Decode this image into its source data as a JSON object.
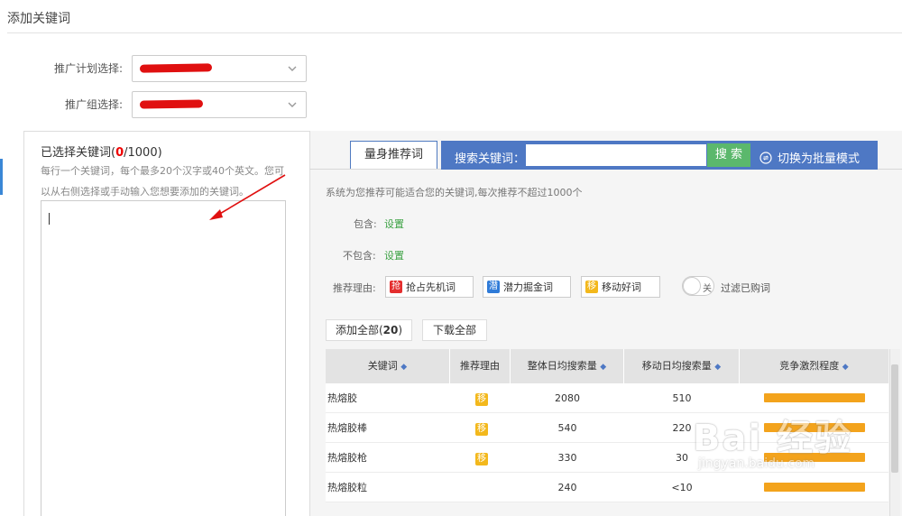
{
  "page_title": "添加关键词",
  "form": {
    "plan_label": "推广计划选择:",
    "group_label": "推广组选择:"
  },
  "selected": {
    "title_prefix": "已选择关键词(",
    "count": "0",
    "title_suffix": "/1000)",
    "hint_line1": "每行一个关键词，每个最多20个汉字或40个英文。您可",
    "hint_line2": "以从右侧选择或手动输入您想要添加的关键词。"
  },
  "tabs": {
    "tailored": "量身推荐词",
    "search_label": "搜索关键词：",
    "search_input_value": "",
    "search_button": "搜 索",
    "bulk_mode": "切换为批量模式"
  },
  "system_note": "系统为您推荐可能适合您的关键词,每次推荐不超过1000个",
  "filters": {
    "include_label": "包含:",
    "include_link": "设置",
    "exclude_label": "不包含:",
    "exclude_link": "设置",
    "reason_label": "推荐理由:",
    "reasons": [
      {
        "tag": "抢",
        "label": "抢占先机词",
        "color": "#e42e2e"
      },
      {
        "tag": "潜",
        "label": "潜力掘金词",
        "color": "#2f7bd8"
      },
      {
        "tag": "移",
        "label": "移动好词",
        "color": "#f3b81c"
      }
    ],
    "toggle_state": "关",
    "filter_purchased": "过滤已购词"
  },
  "actions": {
    "add_all_prefix": "添加全部(",
    "add_all_count": "20",
    "add_all_suffix": ")",
    "download_all": "下载全部"
  },
  "table": {
    "columns": [
      "关键词",
      "推荐理由",
      "整体日均搜索量",
      "移动日均搜索量",
      "竞争激烈程度"
    ],
    "sort_icon": "◆",
    "rows": [
      {
        "keyword": "热熔胶",
        "reason_tag": "移",
        "total": "2080",
        "mobile": "510",
        "competition": 1.0
      },
      {
        "keyword": "热熔胶棒",
        "reason_tag": "移",
        "total": "540",
        "mobile": "220",
        "competition": 1.0
      },
      {
        "keyword": "热熔胶枪",
        "reason_tag": "移",
        "total": "330",
        "mobile": "30",
        "competition": 1.0
      },
      {
        "keyword": "热熔胶粒",
        "reason_tag": "",
        "total": "240",
        "mobile": "<10",
        "competition": 1.0
      }
    ]
  },
  "watermark": {
    "top": "Bai 经验",
    "bottom": "jingyan.baidu.com"
  },
  "colors": {
    "accent_blue": "#4e78c4",
    "search_green": "#5bb86c",
    "link_green": "#3aa142",
    "bar_orange": "#f3a31c",
    "annotation_red": "#e01010"
  }
}
